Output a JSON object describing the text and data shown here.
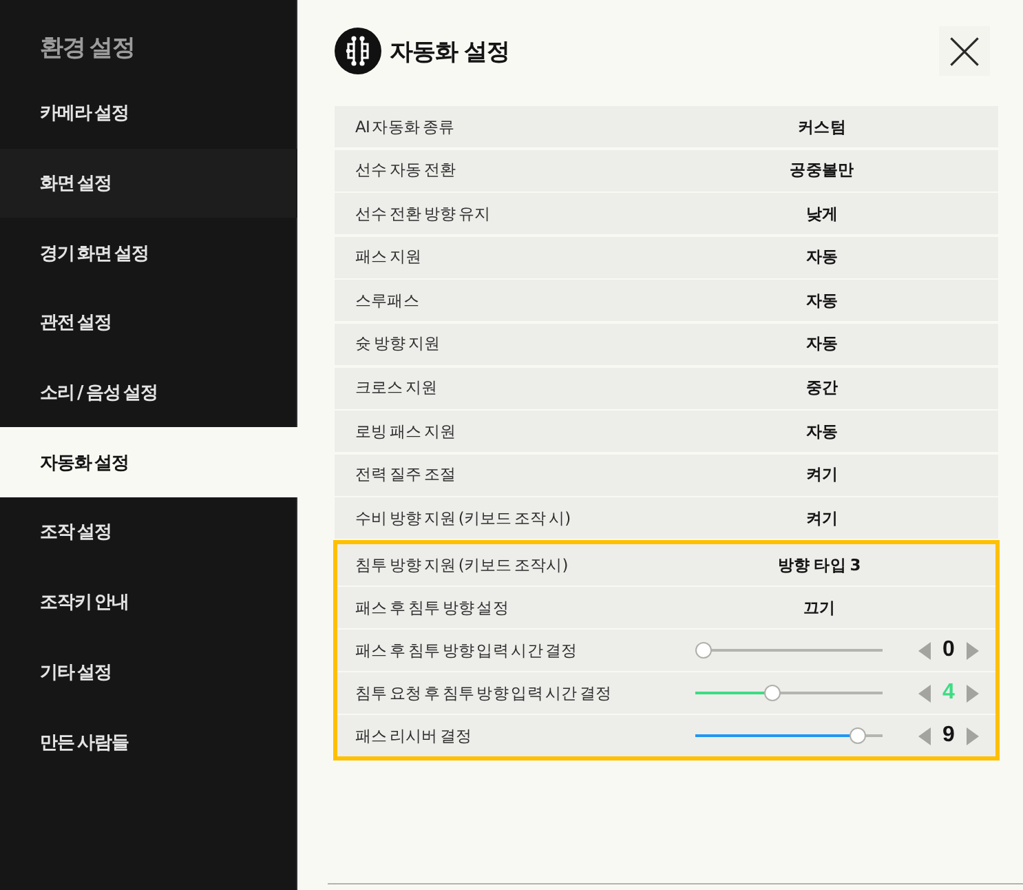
{
  "sidebar": {
    "title": "환경 설정",
    "items": [
      {
        "label": "카메라 설정",
        "selected": false,
        "hovered": false
      },
      {
        "label": "화면 설정",
        "selected": false,
        "hovered": true
      },
      {
        "label": "경기 화면 설정",
        "selected": false,
        "hovered": false
      },
      {
        "label": "관전 설정",
        "selected": false,
        "hovered": false
      },
      {
        "label": "소리 / 음성 설정",
        "selected": false,
        "hovered": false
      },
      {
        "label": "자동화 설정",
        "selected": true,
        "hovered": false
      },
      {
        "label": "조작 설정",
        "selected": false,
        "hovered": false
      },
      {
        "label": "조작키 안내",
        "selected": false,
        "hovered": false
      },
      {
        "label": "기타 설정",
        "selected": false,
        "hovered": false
      },
      {
        "label": "만든 사람들",
        "selected": false,
        "hovered": false
      }
    ]
  },
  "panel": {
    "title": "자동화 설정"
  },
  "groups": [
    {
      "highlighted": false,
      "rows": [
        {
          "kind": "option",
          "label": "AI 자동화 종류",
          "value": "커스텀"
        },
        {
          "kind": "option",
          "label": "선수 자동 전환",
          "value": "공중볼만"
        },
        {
          "kind": "option",
          "label": "선수 전환 방향 유지",
          "value": "낮게"
        },
        {
          "kind": "option",
          "label": "패스 지원",
          "value": "자동"
        },
        {
          "kind": "option",
          "label": "스루패스",
          "value": "자동"
        },
        {
          "kind": "option",
          "label": "슛 방향 지원",
          "value": "자동"
        },
        {
          "kind": "option",
          "label": "크로스 지원",
          "value": "중간"
        },
        {
          "kind": "option",
          "label": "로빙 패스 지원",
          "value": "자동"
        },
        {
          "kind": "option",
          "label": "전력 질주 조절",
          "value": "켜기"
        },
        {
          "kind": "option",
          "label": "수비 방향 지원 (키보드 조작 시)",
          "value": "켜기"
        }
      ]
    },
    {
      "highlighted": true,
      "rows": [
        {
          "kind": "option",
          "label": "침투 방향 지원 (키보드 조작시)",
          "value": "방향 타입 3"
        },
        {
          "kind": "option",
          "label": "패스 후 침투 방향 설정",
          "value": "끄기"
        },
        {
          "kind": "slider",
          "label": "패스 후 침투 방향 입력 시간 결정",
          "level": 0,
          "reading": "0",
          "modified": false
        },
        {
          "kind": "slider",
          "label": "침투 요청 후 침투 방향 입력 시간 결정",
          "level": 0.4,
          "reading": "4",
          "modified": true,
          "color": "#3ddc84"
        },
        {
          "kind": "slider",
          "label": "패스 리시버 결정",
          "level": 0.9,
          "reading": "9",
          "modified": false,
          "color": "#2196f3"
        }
      ]
    }
  ]
}
